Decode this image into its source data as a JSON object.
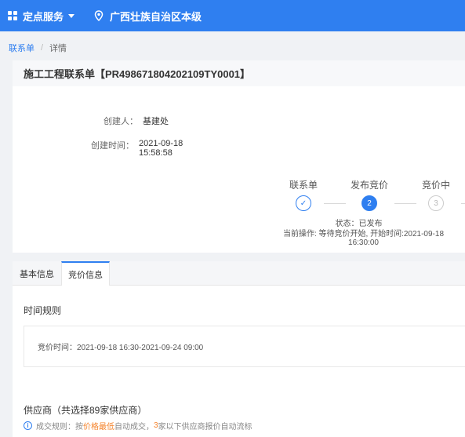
{
  "topbar": {
    "service_label": "定点服务",
    "region_label": "广西壮族自治区本级",
    "bg_color": "#2f7ff0"
  },
  "breadcrumb": {
    "root": "联系单",
    "current": "详情"
  },
  "page": {
    "title": "施工工程联系单【PR498671804202109TY0001】"
  },
  "info": {
    "creator_label": "创建人：",
    "creator_value": "基建处",
    "created_time_label": "创建时间：",
    "created_time_value": "2021-09-18 15:58:58"
  },
  "steps": {
    "items": [
      {
        "label": "联系单",
        "marker": "✓",
        "state": "done"
      },
      {
        "label": "发布竞价",
        "marker": "2",
        "state": "active"
      },
      {
        "label": "竞价中",
        "marker": "3",
        "state": "wait"
      }
    ],
    "status": "状态：已发布",
    "current_op": "当前操作: 等待竞价开始, 开始时间:2021-09-18 16:30:00"
  },
  "tabs": [
    {
      "label": "基本信息",
      "active": false
    },
    {
      "label": "竞价信息",
      "active": true
    }
  ],
  "time_rules": {
    "title": "时间规则",
    "bid_time": "竞价时间：2021-09-18 16:30-2021-09-24 09:00"
  },
  "suppliers": {
    "title": "供应商（共选择89家供应商）",
    "rule_prefix": "成交规则：按",
    "rule_highlight1": "价格最低",
    "rule_mid": "自动成交，",
    "rule_highlight2": "3",
    "rule_suffix": "家以下供应商报价自动流标"
  }
}
